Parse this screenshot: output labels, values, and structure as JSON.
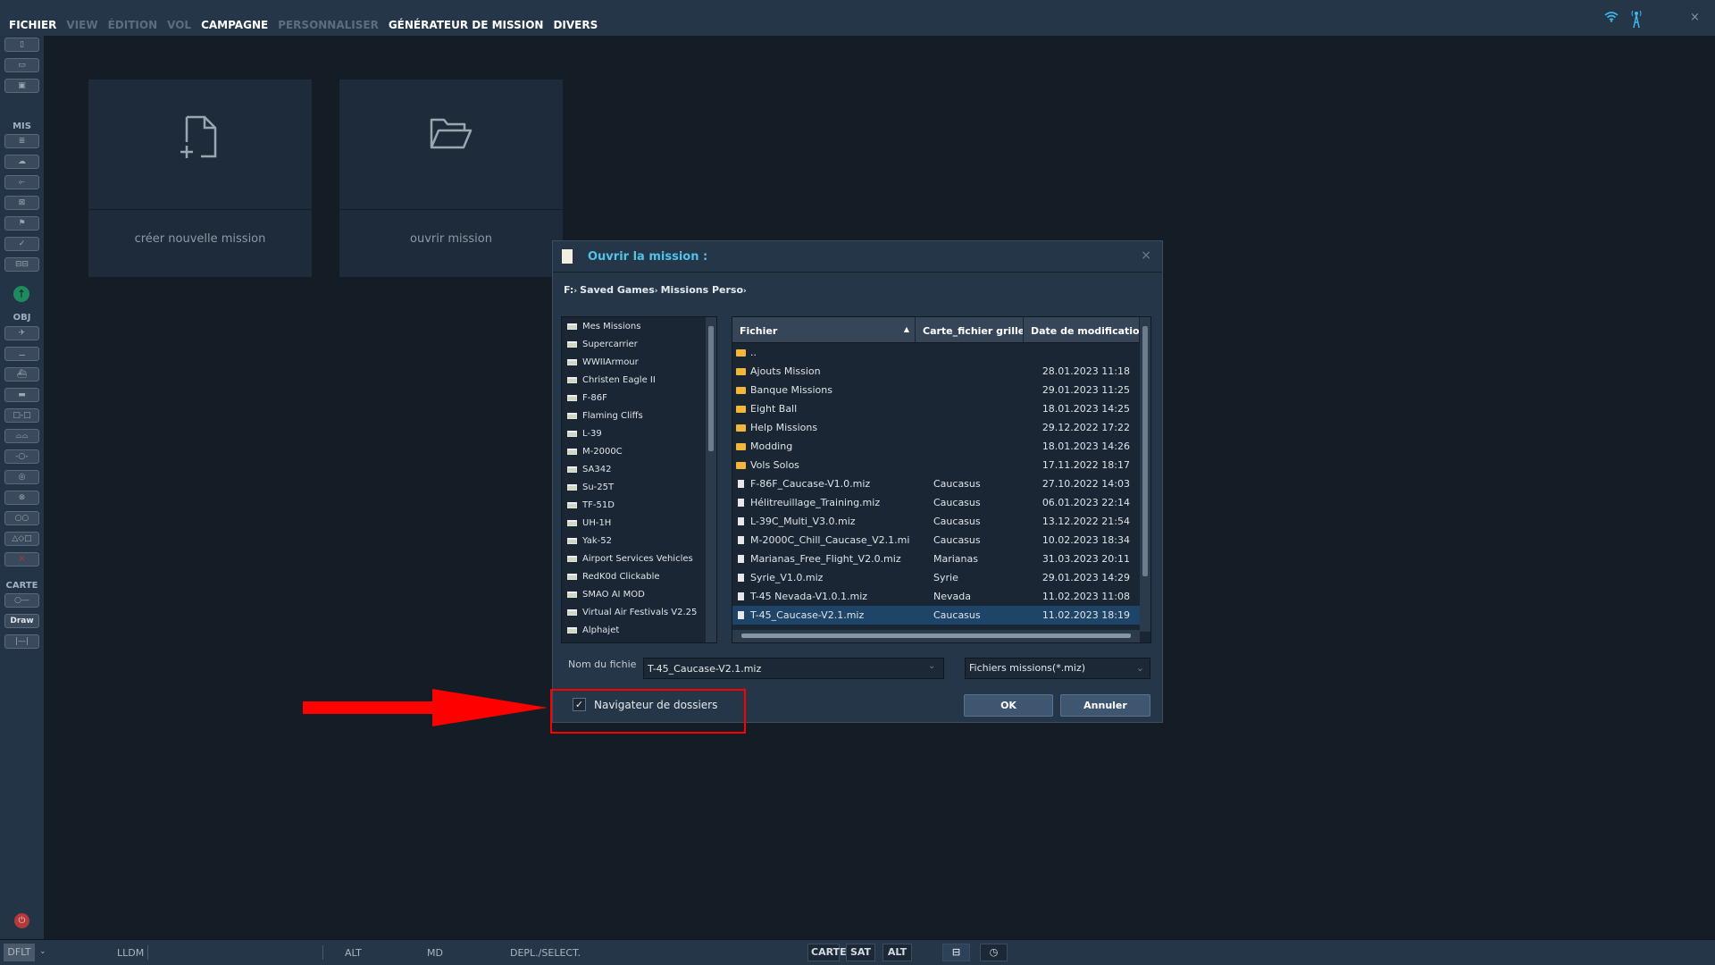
{
  "menu": [
    {
      "label": "FICHIER",
      "enabled": true
    },
    {
      "label": "VIEW",
      "enabled": false
    },
    {
      "label": "ÉDITION",
      "enabled": false
    },
    {
      "label": "VOL",
      "enabled": false
    },
    {
      "label": "CAMPAGNE",
      "enabled": true
    },
    {
      "label": "PERSONNALISER",
      "enabled": false
    },
    {
      "label": "GÉNÉRATEUR DE MISSION",
      "enabled": true
    },
    {
      "label": "DIVERS",
      "enabled": true
    }
  ],
  "toolbar": {
    "mis_label": "MIS",
    "obj_label": "OBJ",
    "carte_label": "CARTE",
    "draw_label": "Draw"
  },
  "tiles": {
    "new_mission": "créer nouvelle mission",
    "open_mission": "ouvrir mission"
  },
  "dialog": {
    "title": "Ouvrir la mission :",
    "breadcrumb": [
      "F:",
      "Saved Games",
      "Missions Perso"
    ],
    "folders": [
      "Mes Missions",
      "Supercarrier",
      "WWIIArmour",
      "Christen Eagle II",
      "F-86F",
      "Flaming Cliffs",
      "L-39",
      "M-2000C",
      "SA342",
      "Su-25T",
      "TF-51D",
      "UH-1H",
      "Yak-52",
      "Airport Services Vehicles",
      "RedK0d Clickable",
      "SMAO AI MOD",
      "Virtual Air Festivals V2.25",
      "Alphajet"
    ],
    "columns": [
      "Fichier",
      "Carte_fichier grille",
      "Date de modification"
    ],
    "files": [
      {
        "type": "folder",
        "name": "..",
        "map": "",
        "date": ""
      },
      {
        "type": "folder",
        "name": "Ajouts Mission",
        "map": "",
        "date": "28.01.2023 11:18"
      },
      {
        "type": "folder",
        "name": "Banque Missions",
        "map": "",
        "date": "29.01.2023 11:25"
      },
      {
        "type": "folder",
        "name": "Eight Ball",
        "map": "",
        "date": "18.01.2023 14:25"
      },
      {
        "type": "folder",
        "name": "Help Missions",
        "map": "",
        "date": "29.12.2022 17:22"
      },
      {
        "type": "folder",
        "name": "Modding",
        "map": "",
        "date": "18.01.2023 14:26"
      },
      {
        "type": "folder",
        "name": "Vols Solos",
        "map": "",
        "date": "17.11.2022 18:17"
      },
      {
        "type": "file",
        "name": "F-86F_Caucase-V1.0.miz",
        "map": "Caucasus",
        "date": "27.10.2022 14:03"
      },
      {
        "type": "file",
        "name": "Hélitreuillage_Training.miz",
        "map": "Caucasus",
        "date": "06.01.2023 22:14"
      },
      {
        "type": "file",
        "name": "L-39C_Multi_V3.0.miz",
        "map": "Caucasus",
        "date": "13.12.2022 21:54"
      },
      {
        "type": "file",
        "name": "M-2000C_Chill_Caucase_V2.1.mi",
        "map": "Caucasus",
        "date": "10.02.2023 18:34"
      },
      {
        "type": "file",
        "name": "Marianas_Free_Flight_V2.0.miz",
        "map": "Marianas",
        "date": "31.03.2023 20:11"
      },
      {
        "type": "file",
        "name": "Syrie_V1.0.miz",
        "map": "Syrie",
        "date": "29.01.2023 14:29"
      },
      {
        "type": "file",
        "name": "T-45 Nevada-V1.0.1.miz",
        "map": "Nevada",
        "date": "11.02.2023 11:08"
      },
      {
        "type": "file",
        "name": "T-45_Caucase-V2.1.miz",
        "map": "Caucasus",
        "date": "11.02.2023 18:19",
        "selected": true
      }
    ],
    "filename_label": "Nom du fichie",
    "filename_value": "T-45_Caucase-V2.1.miz",
    "filter_value": "Fichiers missions(*.miz)",
    "folder_browser_label": "Navigateur de dossiers",
    "folder_browser_checked": true,
    "ok_label": "OK",
    "cancel_label": "Annuler"
  },
  "statusbar": {
    "mode": "DFLT",
    "coords": "LLDM",
    "alt": "ALT",
    "md": "MD",
    "action": "DEPL./SELECT.",
    "map_buttons": [
      "CARTE",
      "SAT",
      "ALT"
    ]
  },
  "colors": {
    "accent": "#4fc3e8",
    "highlight_annotation": "#ff0000",
    "selected_row": "#1e4567"
  }
}
